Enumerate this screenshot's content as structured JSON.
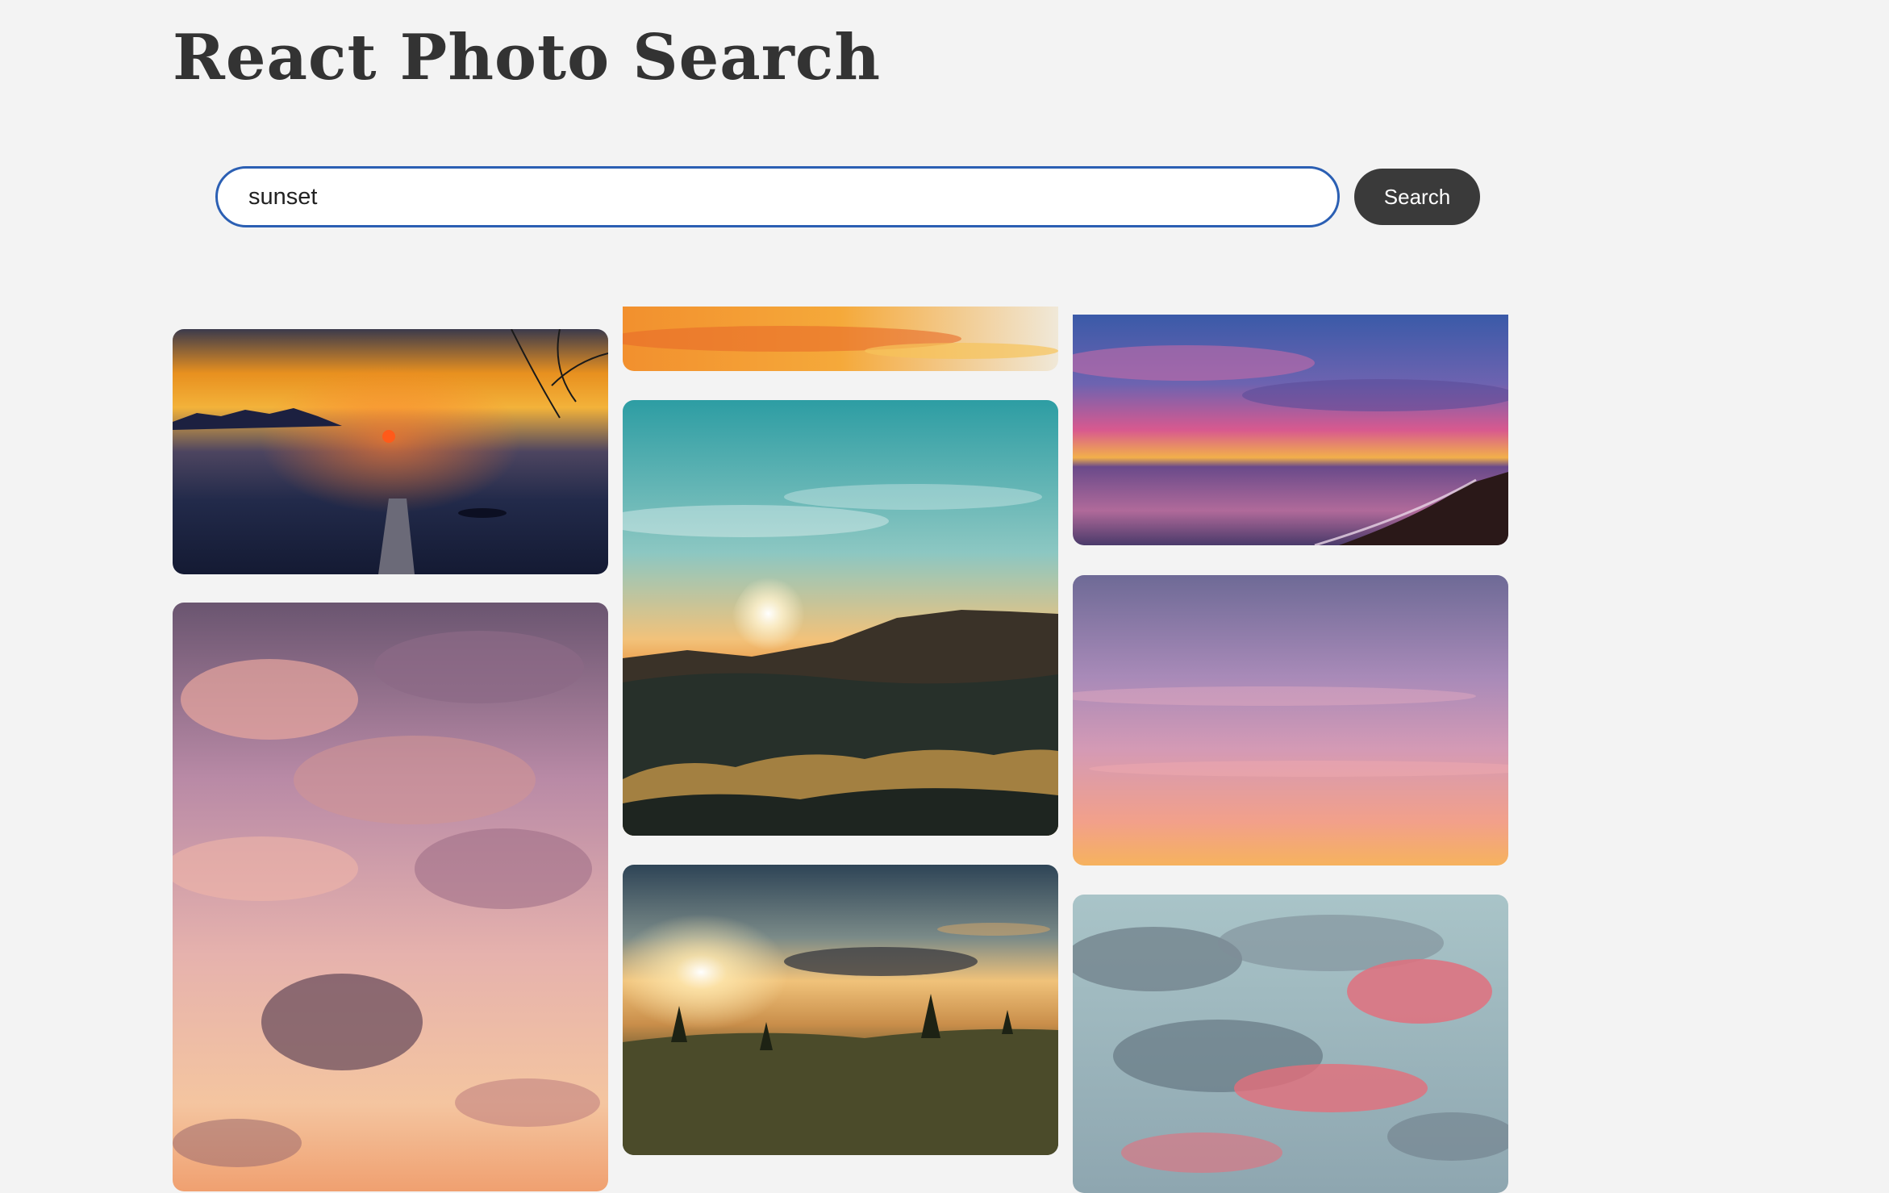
{
  "header": {
    "title": "React Photo Search"
  },
  "search": {
    "value": "sunset",
    "button_label": "Search"
  },
  "gallery": {
    "photos": [
      {
        "name": "lake-pier-sunset-photo",
        "column": 1
      },
      {
        "name": "pink-cloudy-sky-photo",
        "column": 1
      },
      {
        "name": "orange-cloud-strip-photo",
        "column": 2
      },
      {
        "name": "mountain-sunrise-photo",
        "column": 2
      },
      {
        "name": "misty-meadow-sunrise-photo",
        "column": 2
      },
      {
        "name": "seashore-sunset-photo",
        "column": 3
      },
      {
        "name": "lavender-gradient-sky-photo",
        "column": 3
      },
      {
        "name": "pink-grey-clouds-photo",
        "column": 3
      }
    ]
  }
}
